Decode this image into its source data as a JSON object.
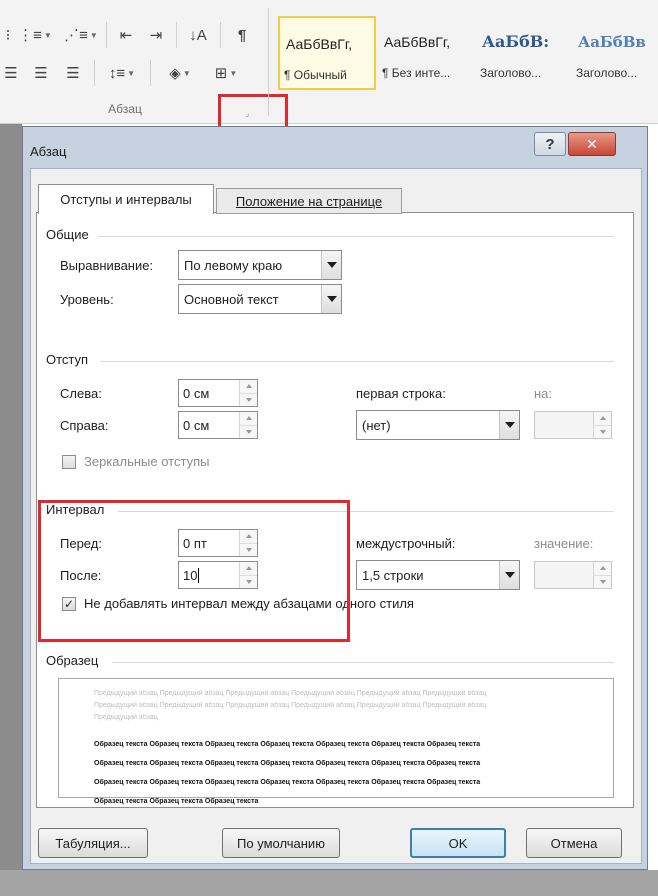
{
  "ribbon": {
    "group_label": "Абзац",
    "styles": [
      {
        "sample": "АаБбВвГг,",
        "name": "¶ Обычный",
        "kind": "normal"
      },
      {
        "sample": "АаБбВвГг,",
        "name": "¶ Без инте...",
        "kind": "normal"
      },
      {
        "sample": "АаБбВ:",
        "name": "Заголово...",
        "kind": "heading"
      },
      {
        "sample": "АаБбВв",
        "name": "Заголово...",
        "kind": "heading2"
      }
    ]
  },
  "dialog": {
    "title": "Абзац",
    "help_label": "?",
    "close_label": "✕",
    "tabs": [
      "Отступы и интервалы",
      "Положение на странице"
    ],
    "general": {
      "title": "Общие",
      "alignment_label": "Выравнивание:",
      "alignment_value": "По левому краю",
      "level_label": "Уровень:",
      "level_value": "Основной текст"
    },
    "indent": {
      "title": "Отступ",
      "left_label": "Слева:",
      "left_value": "0 см",
      "right_label": "Справа:",
      "right_value": "0 см",
      "first_line_label": "первая строка:",
      "first_line_value": "(нет)",
      "by_label": "на:",
      "mirror_label": "Зеркальные отступы"
    },
    "spacing": {
      "title": "Интервал",
      "before_label": "Перед:",
      "before_value": "0 пт",
      "after_label": "После:",
      "after_value": "10",
      "line_label": "междустрочный:",
      "line_value": "1,5 строки",
      "at_label": "значение:",
      "no_space_label": "Не добавлять интервал между абзацами одного стиля"
    },
    "preview": {
      "title": "Образец",
      "prev_lines": [
        "Предыдущий абзац Предыдущий абзац Предыдущий абзац Предыдущий абзац Предыдущий абзац Предыдущий абзац",
        "Предыдущий абзац Предыдущий абзац Предыдущий абзац Предыдущий абзац Предыдущий абзац Предыдущий абзац",
        "Предыдущий абзац"
      ],
      "sample_lines": [
        "Образец текста Образец текста Образец текста Образец текста Образец текста Образец текста Образец текста",
        "Образец текста Образец текста Образец текста Образец текста Образец текста Образец текста Образец текста",
        "Образец текста Образец текста Образец текста Образец текста Образец текста Образец текста Образец текста",
        "Образец текста Образец текста Образец текста"
      ]
    },
    "buttons": {
      "tabs": "Табуляция...",
      "default": "По умолчанию",
      "ok": "OK",
      "cancel": "Отмена"
    }
  }
}
